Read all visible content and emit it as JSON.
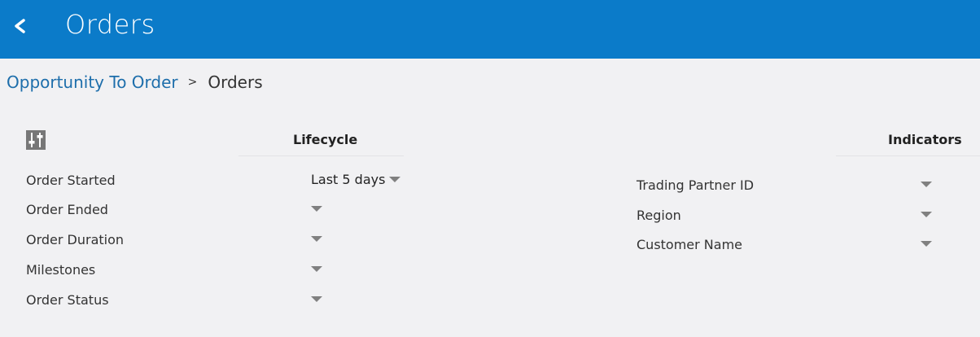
{
  "header": {
    "title": "Orders",
    "back_icon": "chevron-left-icon",
    "background": "#0b7bc9"
  },
  "breadcrumb": {
    "parent": "Opportunity To Order",
    "separator": ">",
    "current": "Orders"
  },
  "toolbar": {
    "settings_icon": "sliders-icon"
  },
  "lifecycle": {
    "title": "Lifecycle",
    "filters": [
      {
        "label": "Order Started",
        "value": "Last 5 days"
      },
      {
        "label": "Order Ended",
        "value": ""
      },
      {
        "label": "Order Duration",
        "value": ""
      },
      {
        "label": "Milestones",
        "value": ""
      },
      {
        "label": "Order Status",
        "value": ""
      }
    ]
  },
  "indicators": {
    "title": "Indicators",
    "filters": [
      {
        "label": "Trading Partner ID",
        "value": ""
      },
      {
        "label": "Region",
        "value": ""
      },
      {
        "label": "Customer Name",
        "value": ""
      }
    ]
  }
}
